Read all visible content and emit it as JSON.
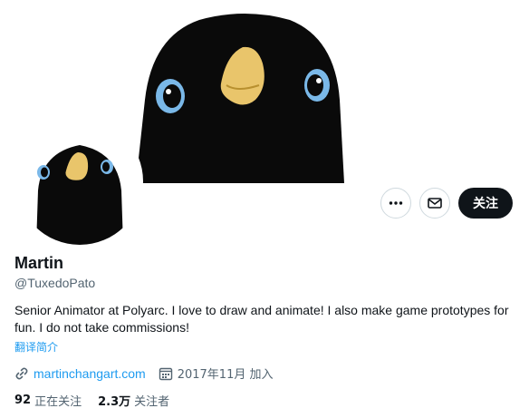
{
  "banner": {
    "image_name": "penguin-banner-image"
  },
  "avatar": {
    "image_name": "penguin-avatar-image"
  },
  "actions": {
    "more_icon": "more-horizontal-icon",
    "message_icon": "envelope-icon",
    "follow_label": "关注"
  },
  "profile": {
    "name": "Martin",
    "handle": "@TuxedoPato",
    "bio": "Senior Animator at Polyarc. I love to draw and animate! I also make game prototypes for fun. I do not take commissions!",
    "translate_label": "翻译简介",
    "website": "martinchangart.com",
    "joined": "2017年11月 加入"
  },
  "stats": {
    "following_count": "92",
    "following_label": "正在关注",
    "followers_count": "2.3万",
    "followers_label": "关注者"
  },
  "colors": {
    "link": "#1d9bf0",
    "text": "#0f1419",
    "muted": "#536471",
    "button_dark": "#0f1419"
  }
}
